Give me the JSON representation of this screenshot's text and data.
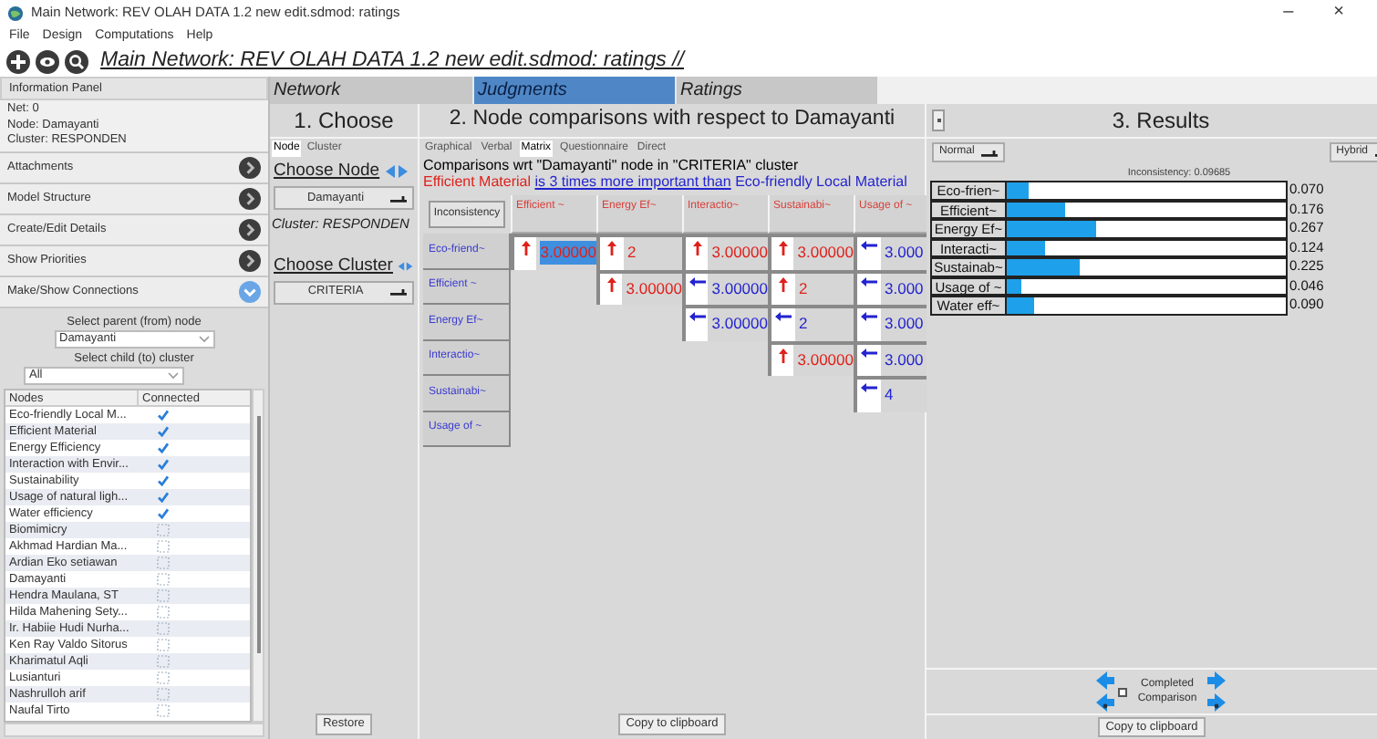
{
  "window": {
    "title": "Main Network: REV OLAH DATA 1.2 new edit.sdmod: ratings",
    "controls": [
      "–",
      "×"
    ]
  },
  "menu": [
    "File",
    "Design",
    "Computations",
    "Help"
  ],
  "toolbar": {
    "title": "Main Network: REV OLAH DATA 1.2 new edit.sdmod: ratings //"
  },
  "info_panel": {
    "header": "Information Panel",
    "lines": [
      "Net: 0",
      "Node: Damayanti",
      "Cluster: RESPONDEN"
    ]
  },
  "accordion": [
    {
      "label": "Attachments",
      "expanded": false
    },
    {
      "label": "Model Structure",
      "expanded": false
    },
    {
      "label": "Create/Edit Details",
      "expanded": false
    },
    {
      "label": "Show Priorities",
      "expanded": false
    },
    {
      "label": "Make/Show Connections",
      "expanded": true
    }
  ],
  "connections": {
    "parent_label": "Select parent (from) node",
    "parent_value": "Damayanti",
    "child_label": "Select child (to) cluster",
    "child_value": "All",
    "columns": [
      "Nodes",
      "Connected"
    ],
    "rows": [
      {
        "name": "Eco-friendly Local M...",
        "connected": true
      },
      {
        "name": "Efficient Material",
        "connected": true
      },
      {
        "name": "Energy Efficiency",
        "connected": true
      },
      {
        "name": "Interaction with Envir...",
        "connected": true
      },
      {
        "name": "Sustainability",
        "connected": true
      },
      {
        "name": "Usage of natural ligh...",
        "connected": true
      },
      {
        "name": "Water efficiency",
        "connected": true
      },
      {
        "name": "Biomimicry",
        "connected": false
      },
      {
        "name": "Akhmad Hardian Ma...",
        "connected": false
      },
      {
        "name": "Ardian Eko setiawan",
        "connected": false
      },
      {
        "name": "Damayanti",
        "connected": false
      },
      {
        "name": "Hendra Maulana, ST",
        "connected": false
      },
      {
        "name": "Hilda Mahening Sety...",
        "connected": false
      },
      {
        "name": "Ir. Habiie Hudi Nurha...",
        "connected": false
      },
      {
        "name": "Ken Ray Valdo Sitorus",
        "connected": false
      },
      {
        "name": "Kharimatul Aqli",
        "connected": false
      },
      {
        "name": "Lusianturi",
        "connected": false
      },
      {
        "name": "Nashrulloh arif",
        "connected": false
      },
      {
        "name": "Naufal Tirto",
        "connected": false
      }
    ]
  },
  "main_tabs": [
    {
      "label": "Network",
      "selected": false
    },
    {
      "label": "Judgments",
      "selected": true
    },
    {
      "label": "Ratings",
      "selected": false
    }
  ],
  "choose": {
    "title": "1. Choose",
    "tabs": [
      {
        "label": "Node",
        "selected": true
      },
      {
        "label": "Cluster",
        "selected": false
      }
    ],
    "node_heading": "Choose Node",
    "node_value": "Damayanti",
    "cluster_info": "Cluster: RESPONDEN",
    "cluster_heading": "Choose Cluster",
    "cluster_value": "CRITERIA",
    "restore": "Restore"
  },
  "comparisons": {
    "title": "2. Node comparisons with respect to Damayanti",
    "tabs": [
      {
        "label": "Graphical",
        "selected": false
      },
      {
        "label": "Verbal",
        "selected": false
      },
      {
        "label": "Matrix",
        "selected": true
      },
      {
        "label": "Questionnaire",
        "selected": false
      },
      {
        "label": "Direct",
        "selected": false
      }
    ],
    "heading": "Comparisons wrt \"Damayanti\" node in \"CRITERIA\" cluster",
    "judgment": {
      "subject": "Efficient Material",
      "relation": "is 3 times more important than",
      "object": "Eco-friendly Local Material"
    },
    "inconsistency_button": "Inconsistency",
    "columns": [
      "Efficient ~",
      "Energy Ef~",
      "Interactio~",
      "Sustainabi~",
      "Usage of ~"
    ],
    "rows": [
      {
        "label": "Eco-friend~",
        "cells": [
          {
            "kind": "up",
            "value": "3.00000",
            "selected": true
          },
          {
            "kind": "up",
            "value": "2",
            "selected": false
          },
          {
            "kind": "up",
            "value": "3.00000",
            "selected": false
          },
          {
            "kind": "up",
            "value": "3.00000",
            "selected": false
          },
          {
            "kind": "left",
            "value": "3.000",
            "selected": false
          }
        ]
      },
      {
        "label": "Efficient ~",
        "cells": [
          "",
          {
            "kind": "up",
            "value": "3.00000",
            "selected": false
          },
          {
            "kind": "left",
            "value": "3.00000",
            "selected": false
          },
          {
            "kind": "up",
            "value": "2",
            "selected": false
          },
          {
            "kind": "left",
            "value": "3.000",
            "selected": false
          }
        ]
      },
      {
        "label": "Energy Ef~",
        "cells": [
          "",
          "",
          {
            "kind": "left",
            "value": "3.00000",
            "selected": false
          },
          {
            "kind": "left",
            "value": "2",
            "selected": false
          },
          {
            "kind": "left",
            "value": "3.000",
            "selected": false
          }
        ]
      },
      {
        "label": "Interactio~",
        "cells": [
          "",
          "",
          "",
          {
            "kind": "up",
            "value": "3.00000",
            "selected": false
          },
          {
            "kind": "left",
            "value": "3.000",
            "selected": false
          }
        ]
      },
      {
        "label": "Sustainabi~",
        "cells": [
          "",
          "",
          "",
          "",
          {
            "kind": "left",
            "value": "4",
            "selected": false
          }
        ]
      },
      {
        "label": "Usage of ~",
        "cells": [
          "",
          "",
          "",
          "",
          ""
        ]
      }
    ],
    "copy": "Copy to clipboard"
  },
  "results": {
    "title": "3. Results",
    "mode": "Normal",
    "hybrid": "Hybrid",
    "inconsistency": "Inconsistency: 0.09685",
    "priorities": [
      {
        "label": "Eco-frien~",
        "level": 0.08,
        "value": "0.070"
      },
      {
        "label": "Efficient~",
        "level": 0.21,
        "value": "0.176"
      },
      {
        "label": "Energy Ef~",
        "level": 0.32,
        "value": "0.267"
      },
      {
        "label": "Interacti~",
        "level": 0.14,
        "value": "0.124"
      },
      {
        "label": "Sustainab~",
        "level": 0.26,
        "value": "0.225"
      },
      {
        "label": "Usage of ~",
        "level": 0.05,
        "value": "0.046"
      },
      {
        "label": "Water eff~",
        "level": 0.1,
        "value": "0.090"
      }
    ],
    "completed": {
      "label": "Completed Comparison",
      "checked": false
    },
    "copy": "Copy to clipboard"
  }
}
